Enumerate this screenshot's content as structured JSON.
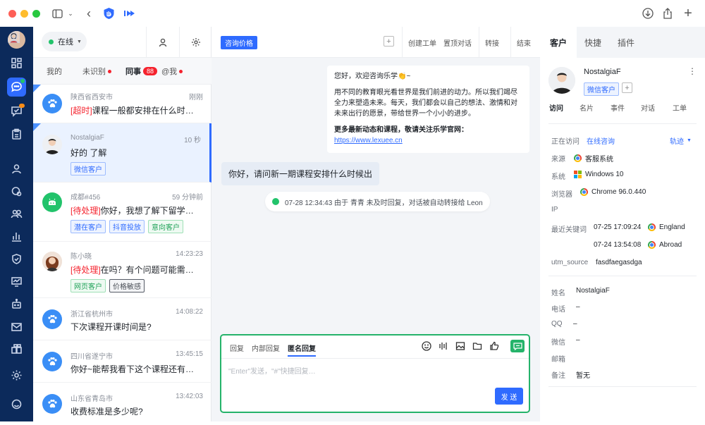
{
  "session_list": {
    "status": "在线",
    "tabs": [
      {
        "label": "我的"
      },
      {
        "label": "未识别"
      },
      {
        "label": "同事",
        "badge": "88"
      },
      {
        "label": "@我"
      }
    ],
    "items": [
      {
        "name": "陕西省西安市",
        "time": "刚刚",
        "prefix": "[超时]",
        "message": "课程一般都安排在什么时间段…"
      },
      {
        "name": "NostalgiaF",
        "time": "10 秒",
        "message": "好的 了解",
        "tags": [
          "微信客户"
        ]
      },
      {
        "name": "成都#456",
        "time": "59 分钟前",
        "prefix": "[待处理]",
        "message": "你好，我想了解下留学的…",
        "tags": [
          "潜在客户",
          "抖音投放",
          "意向客户"
        ]
      },
      {
        "name": "陈小晓",
        "time": "14:23:23",
        "prefix": "[待处理]",
        "message": "在吗？有个问题可能需要…",
        "tags": [
          "网页客户",
          "价格敏感"
        ]
      },
      {
        "name": "浙江省杭州市",
        "time": "14:08:22",
        "message": "下次课程开课时间是?"
      },
      {
        "name": "四川省遂宁市",
        "time": "13:45:15",
        "message": "你好~能帮我看下这个课程还有名…"
      },
      {
        "name": "山东省青岛市",
        "time": "13:42:03",
        "message": "收费标准是多少呢?"
      }
    ]
  },
  "chat": {
    "topic_tag": "咨询价格",
    "actions": [
      "创建工单",
      "置顶对话",
      "转接",
      "结束"
    ],
    "welcome": {
      "line1": "您好，欢迎咨询乐学👏~",
      "line2": "用不同的教育眼光看世界是我们前进的动力。所以我们竭尽全力来塑造未来。每天，我们都会以自己的想法、激情和对未来出行的愿景，带给世界一个小小的进步。",
      "line3": "更多最新动态和课程，敬请关注乐学官网：",
      "link": "https://www.lexuee.cn"
    },
    "question": "你好，请问新一期课程安排什么时候出",
    "system_notice": "07-28 12:34:43 由于 青青 未及时回复，对话被自动转接给 Leon",
    "input": {
      "tabs": [
        "回复",
        "内部回复",
        "匿名回复"
      ],
      "placeholder": "\"Enter\"发送，\"#\"快捷回复…",
      "send": "发 送"
    }
  },
  "customer_panel": {
    "tabs": [
      "客户",
      "快捷",
      "插件"
    ],
    "name": "NostalgiaF",
    "tag": "微信客户",
    "subtabs": [
      "访问",
      "名片",
      "事件",
      "对话",
      "工单"
    ],
    "visit": {
      "visiting_label": "正在访问",
      "visiting_value": "在线咨询",
      "track_label": "轨迹",
      "source_label": "来源",
      "source_value": "客服系统",
      "os_label": "系统",
      "os_value": "Windows 10",
      "browser_label": "浏览器",
      "browser_value": "Chrome 96.0.440",
      "ip_label": "IP",
      "keyword_label": "最近关键词",
      "keywords": [
        {
          "time": "07-25 17:09:24",
          "value": "England"
        },
        {
          "time": "07-24 13:54:08",
          "value": "Abroad"
        }
      ],
      "utm_label": "utm_source",
      "utm_value": "fasdfaegasdga"
    },
    "profile": [
      {
        "label": "姓名",
        "value": "NostalgiaF"
      },
      {
        "label": "电话",
        "value": "–"
      },
      {
        "label": "QQ",
        "value": "–"
      },
      {
        "label": "微信",
        "value": "–"
      },
      {
        "label": "邮箱",
        "value": ""
      },
      {
        "label": "备注",
        "value": "暂无"
      }
    ]
  },
  "colors": {
    "rail": "#0c2a5b",
    "accent": "#2f6bff",
    "input_border": "#25b36a",
    "warning": "#f5222d"
  }
}
